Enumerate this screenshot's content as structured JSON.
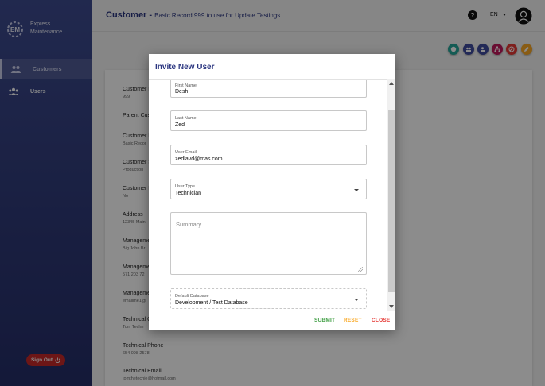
{
  "sidebar": {
    "logo_line1": "Express",
    "logo_line2": "Maintenance",
    "items": [
      {
        "label": "Customers",
        "icon": "customers-icon",
        "active": true
      },
      {
        "label": "Users",
        "icon": "users-icon",
        "active": false
      }
    ],
    "signout_label": "Sign Out"
  },
  "header": {
    "title": "Customer -",
    "subtitle": "Basic Record 999 to use for Update Testings",
    "help": "?",
    "language": "EN"
  },
  "actions": [
    {
      "icon": "info-icon",
      "color": "#26a69a"
    },
    {
      "icon": "users-group-icon",
      "color": "#3f4c9e"
    },
    {
      "icon": "invite-user-icon",
      "color": "#3f4c9e"
    },
    {
      "icon": "hierarchy-icon",
      "color": "#c2185b"
    },
    {
      "icon": "block-icon",
      "color": "#e53935"
    },
    {
      "icon": "edit-icon",
      "color": "#f9a825"
    }
  ],
  "card_fields": [
    {
      "label": "Customer I",
      "value": "999"
    },
    {
      "label": "Parent Cus",
      "value": ""
    },
    {
      "label": "Customer I",
      "value": "Basic Recor"
    },
    {
      "label": "Customer S",
      "value": "Production"
    },
    {
      "label": "Customer I",
      "value": "No"
    },
    {
      "label": "Address",
      "value": "12345 Main"
    },
    {
      "label": "Manageme",
      "value": "Big John Br"
    },
    {
      "label": "Manageme",
      "value": "571 203 72"
    },
    {
      "label": "Manageme",
      "value": "emailme1@"
    },
    {
      "label": "Technical C",
      "value": "Tom Techn"
    },
    {
      "label": "Technical Phone",
      "value": "654 098 2578"
    },
    {
      "label": "Technical Email",
      "value": "tomthetechie@hotmail.com"
    }
  ],
  "modal": {
    "title": "Invite New User",
    "first_name": {
      "label": "First Name",
      "value": "Desh"
    },
    "last_name": {
      "label": "Last Name",
      "value": "Zed"
    },
    "email": {
      "label": "User Email",
      "value": "zedlavd@mas.com"
    },
    "user_type": {
      "label": "User Type",
      "value": "Technician"
    },
    "summary": {
      "placeholder": "Summary",
      "value": ""
    },
    "database": {
      "label": "Default Database",
      "value": "Development / Test Database"
    },
    "buttons": {
      "submit": "SUBMIT",
      "reset": "RESET",
      "close": "CLOSE"
    },
    "colors": {
      "submit": "#43a047",
      "reset": "#f9a825",
      "close": "#e53935"
    }
  }
}
